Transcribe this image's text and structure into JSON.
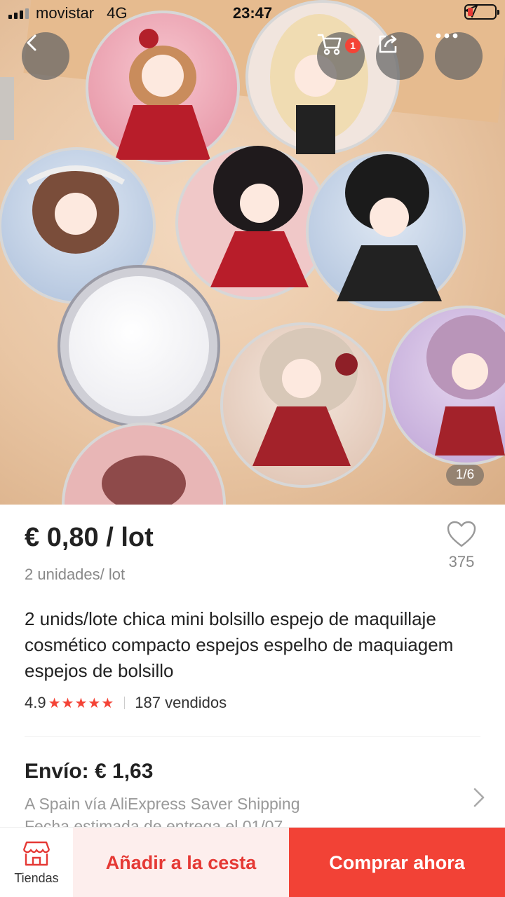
{
  "status_bar": {
    "carrier": "movistar",
    "network": "4G",
    "time": "23:47"
  },
  "header": {
    "cart_badge": "1",
    "image_counter": "1/6"
  },
  "product": {
    "price": "€ 0,80 / lot",
    "unit_info": "2 unidades/ lot",
    "wishlist_count": "375",
    "title": "2 unids/lote chica mini bolsillo espejo de maquillaje cosmético compacto espejos espelho de maquiagem espejos de bolsillo",
    "rating": "4.9",
    "stars": "★★★★★",
    "sold": "187 vendidos"
  },
  "shipping": {
    "title": "Envío: € 1,63",
    "description": "A Spain vía AliExpress Saver Shipping",
    "estimate": "Fecha estimada de entrega el 01/07"
  },
  "bottom_bar": {
    "stores_label": "Tiendas",
    "add_to_cart_label": "Añadir a la cesta",
    "buy_now_label": "Comprar ahora"
  },
  "colors": {
    "accent": "#f24236",
    "star": "#f44336",
    "cart_button_bg": "#fdeeed"
  }
}
